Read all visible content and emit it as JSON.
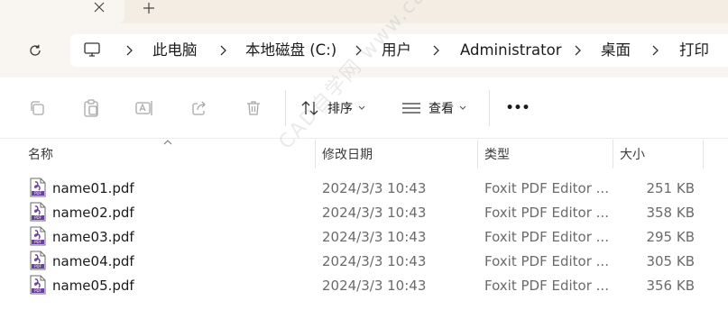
{
  "tabs": {
    "close_icon": "close-icon",
    "new_tab_icon": "plus-icon"
  },
  "address": {
    "refresh_icon": "refresh-icon",
    "pc_icon": "computer-icon",
    "crumbs": [
      "此电脑",
      "本地磁盘 (C:)",
      "用户",
      "Administrator",
      "桌面",
      "打印"
    ]
  },
  "toolbar": {
    "sort_label": "排序",
    "view_label": "查看",
    "more_label": "•••"
  },
  "columns": {
    "name": "名称",
    "date": "修改日期",
    "type": "类型",
    "size": "大小"
  },
  "files": [
    {
      "name": "name01.pdf",
      "date": "2024/3/3 10:43",
      "type": "Foxit PDF Editor ...",
      "size": "251 KB"
    },
    {
      "name": "name02.pdf",
      "date": "2024/3/3 10:43",
      "type": "Foxit PDF Editor ...",
      "size": "358 KB"
    },
    {
      "name": "name03.pdf",
      "date": "2024/3/3 10:43",
      "type": "Foxit PDF Editor ...",
      "size": "295 KB"
    },
    {
      "name": "name04.pdf",
      "date": "2024/3/3 10:43",
      "type": "Foxit PDF Editor ...",
      "size": "305 KB"
    },
    {
      "name": "name05.pdf",
      "date": "2024/3/3 10:43",
      "type": "Foxit PDF Editor ...",
      "size": "356 KB"
    }
  ],
  "watermark": "CAD自学网 www.cadzxw.com",
  "colors": {
    "chrome": "#f3ede4",
    "addr_row": "#f9f6f1",
    "pdf_icon": "#6a3fa0"
  }
}
